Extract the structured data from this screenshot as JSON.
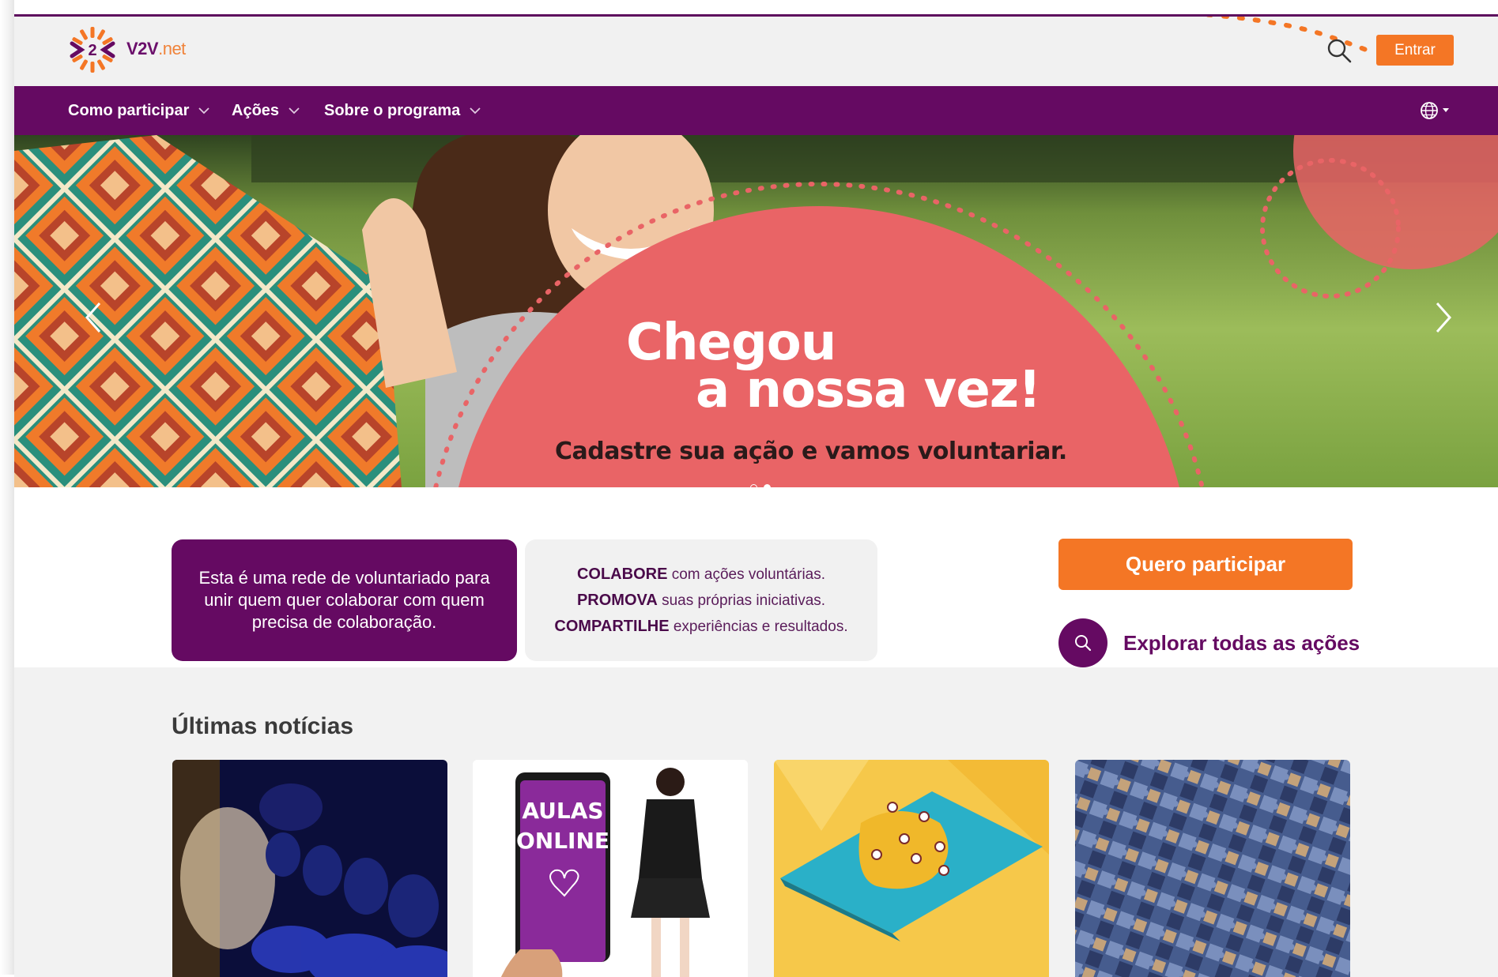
{
  "header": {
    "brand_main": "V2V",
    "brand_suffix": ".net",
    "login_label": "Entrar",
    "brand_colors": {
      "purple": "#650a62",
      "orange": "#f47625"
    }
  },
  "nav": {
    "items": [
      {
        "label": "Como participar"
      },
      {
        "label": "Ações"
      },
      {
        "label": "Sobre o programa"
      }
    ]
  },
  "hero": {
    "title_line1": "Chegou",
    "title_line2": "a nossa vez!",
    "subtitle": "Cadastre sua ação e vamos voluntariar.",
    "slide_count": 2,
    "active_slide": 2
  },
  "intro": {
    "description": "Esta é uma rede de voluntariado para unir quem quer colaborar com quem precisa de colaboração.",
    "lines": [
      {
        "keyword": "COLABORE",
        "text": " com ações voluntárias."
      },
      {
        "keyword": "PROMOVA",
        "text": " suas próprias iniciativas."
      },
      {
        "keyword": "COMPARTILHE",
        "text": " experiências e resultados."
      }
    ],
    "cta_label": "Quero participar",
    "explore_label": "Explorar todas as ações"
  },
  "news": {
    "title": "Últimas notícias",
    "cards": [
      {
        "image": "ballet-dancers-stage"
      },
      {
        "image": "online-classes-phone",
        "text_line1": "AULAS",
        "text_line2": "ONLINE"
      },
      {
        "image": "map-with-pins"
      },
      {
        "image": "puzzle-pieces"
      }
    ]
  }
}
